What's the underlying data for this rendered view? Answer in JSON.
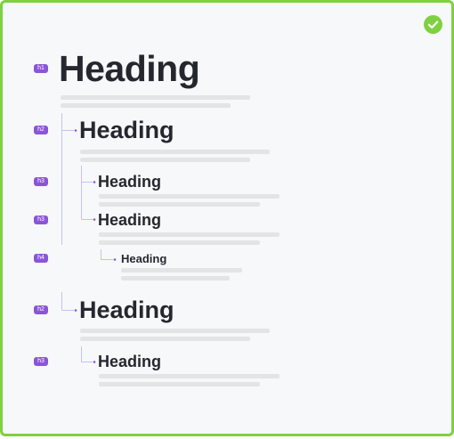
{
  "status_color": "#7ed13f",
  "tag_color": "#8a55d6",
  "status_icon": "check-icon",
  "outline": [
    {
      "level": "h1",
      "tag": "h1",
      "text": "Heading"
    },
    {
      "level": "h2",
      "tag": "h2",
      "text": "Heading"
    },
    {
      "level": "h3",
      "tag": "h3",
      "text": "Heading"
    },
    {
      "level": "h3",
      "tag": "h3",
      "text": "Heading"
    },
    {
      "level": "h4",
      "tag": "h4",
      "text": "Heading"
    },
    {
      "level": "h2",
      "tag": "h2",
      "text": "Heading"
    },
    {
      "level": "h3",
      "tag": "h3",
      "text": "Heading"
    }
  ]
}
